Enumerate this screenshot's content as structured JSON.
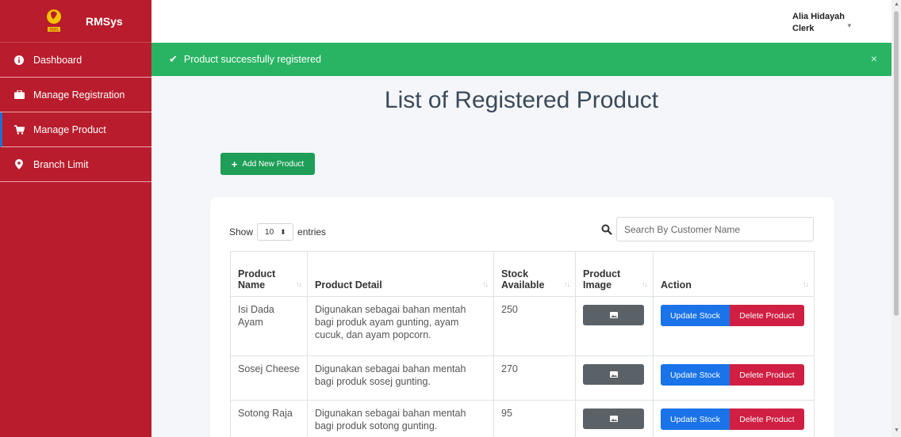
{
  "app": {
    "name": "RMSys"
  },
  "user": {
    "name": "Alia Hidayah",
    "role": "Clerk"
  },
  "sidebar": {
    "items": [
      {
        "label": "Dashboard",
        "icon": "info-circle-icon",
        "active": false
      },
      {
        "label": "Manage Registration",
        "icon": "briefcase-icon",
        "active": false
      },
      {
        "label": "Manage Product",
        "icon": "cart-icon",
        "active": true
      },
      {
        "label": "Branch Limit",
        "icon": "map-pin-icon",
        "active": false
      }
    ]
  },
  "alert": {
    "message": "Product successfully registered",
    "close": "×"
  },
  "page": {
    "title": "List of Registered Product",
    "add_button": "Add New Product"
  },
  "table_controls": {
    "show_label": "Show",
    "entries_value": "10",
    "entries_label": "entries",
    "search_placeholder": "Search By Customer Name"
  },
  "table": {
    "headers": [
      "Product Name",
      "Product Detail",
      "Stock Available",
      "Product Image",
      "Action"
    ],
    "rows": [
      {
        "name": "Isi Dada Ayam",
        "detail": "Digunakan sebagai bahan mentah bagi produk ayam gunting, ayam cucuk, dan ayam popcorn.",
        "stock": "250"
      },
      {
        "name": "Sosej Cheese",
        "detail": "Digunakan sebagai bahan mentah bagi produk sosej gunting.",
        "stock": "270"
      },
      {
        "name": "Sotong Raja",
        "detail": "Digunakan sebagai bahan mentah bagi produk sotong gunting.",
        "stock": "95"
      }
    ],
    "update_label": "Update Stock",
    "delete_label": "Delete Product"
  },
  "colors": {
    "sidebar": "#b91c2c",
    "alert": "#28b463",
    "add_button": "#1e9e57",
    "update_button": "#1a73e8",
    "delete_button": "#d01f42",
    "image_button": "#5a6268"
  }
}
